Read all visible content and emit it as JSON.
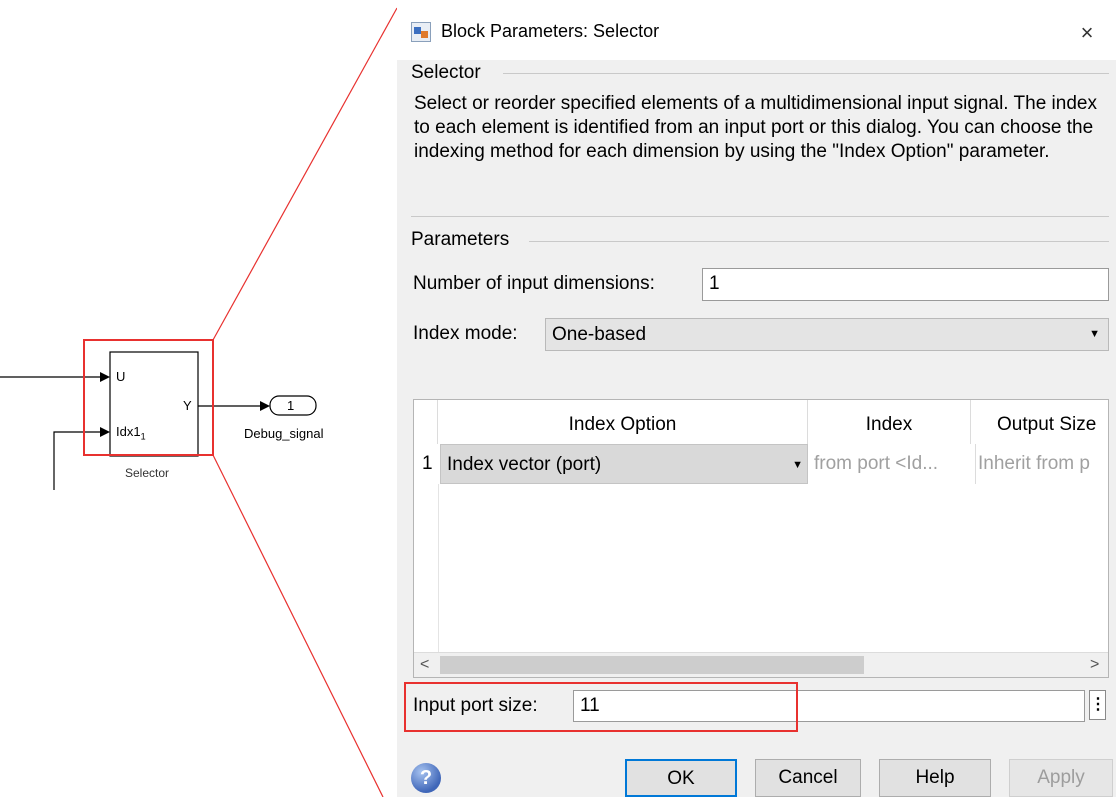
{
  "model": {
    "port_u": "U",
    "port_idx": "Idx1",
    "port_idx_subscript": "1",
    "port_y": "Y",
    "block_name": "Selector",
    "outport_number": "1",
    "outport_name": "Debug_signal"
  },
  "dialog": {
    "title": "Block Parameters: Selector",
    "close_glyph": "×",
    "section_title": "Selector",
    "description": "Select or reorder specified elements of a multidimensional input signal. The index to each element is identified from an input port or this dialog. You can choose the indexing method for each dimension by using the \"Index Option\" parameter.",
    "params_title": "Parameters",
    "num_dims_label": "Number of input dimensions:",
    "num_dims_value": "1",
    "index_mode_label": "Index mode:",
    "index_mode_value": "One-based",
    "table": {
      "headers": [
        "Index Option",
        "Index",
        "Output Size"
      ],
      "rows": [
        {
          "num": "1",
          "option": "Index vector (port)",
          "index": "from port <Id...",
          "output_size": "Inherit from p"
        }
      ]
    },
    "input_port_size_label": "Input port size:",
    "input_port_size_value": "11",
    "buttons": {
      "ok": "OK",
      "cancel": "Cancel",
      "help": "Help",
      "apply": "Apply"
    }
  },
  "colors": {
    "highlight": "#e8312f",
    "ok_border": "#0078d7",
    "dialog_bg": "#f0f0f0"
  },
  "icons": [
    "block-params-icon",
    "close-icon",
    "dropdown-arrow-icon",
    "scroll-left-icon",
    "scroll-right-icon",
    "help-icon"
  ]
}
